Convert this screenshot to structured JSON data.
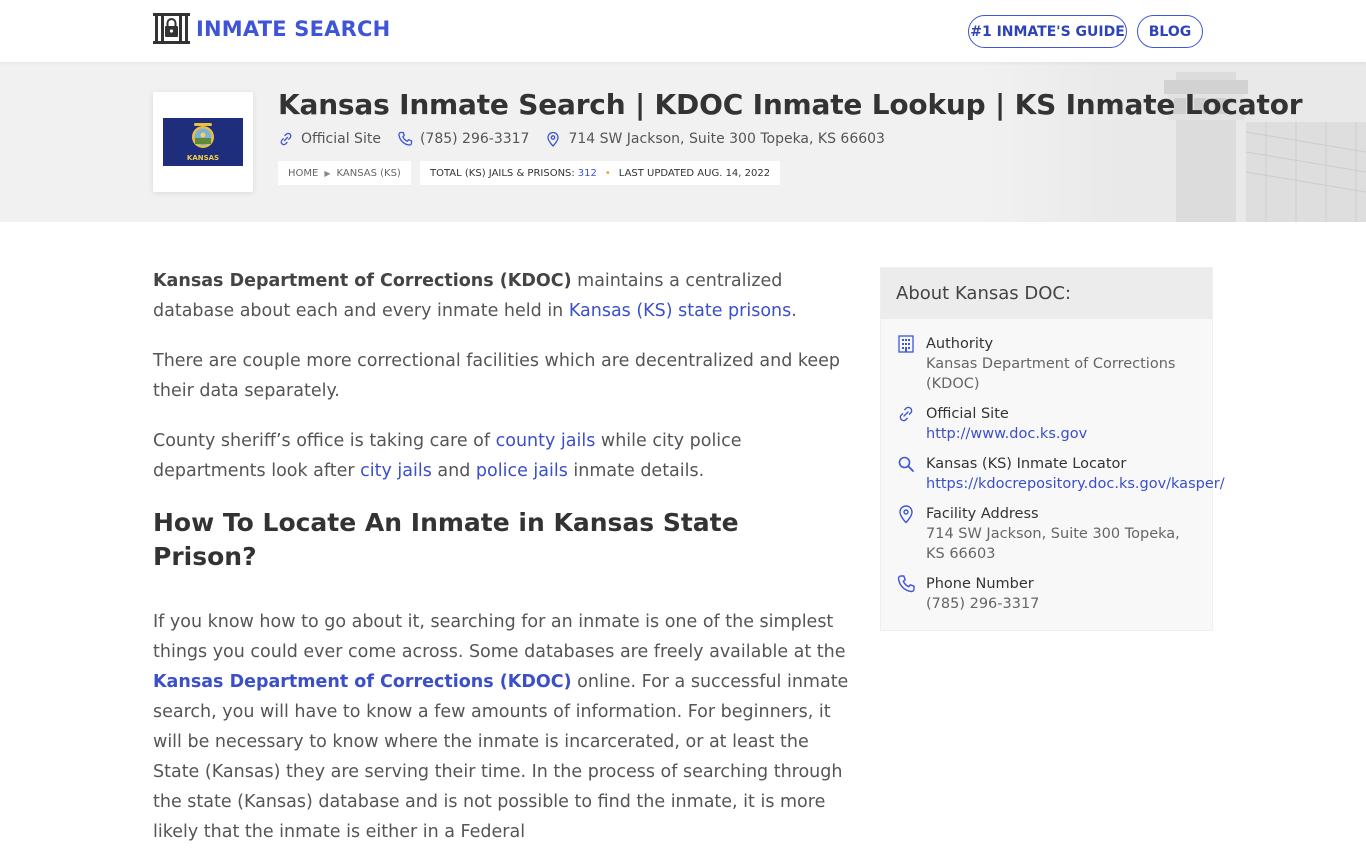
{
  "header": {
    "logo_text": "INMATE SEARCH",
    "nav": {
      "guide": "#1 INMATE'S GUIDE",
      "blog": "BLOG"
    }
  },
  "hero": {
    "flag_text": "KANSAS",
    "title": "Kansas Inmate Search | KDOC Inmate Lookup | KS Inmate Locator",
    "official_site": "Official Site",
    "phone": "(785) 296-3317",
    "address": "714 SW Jackson, Suite 300 Topeka, KS 66603",
    "breadcrumb": {
      "home": "HOME",
      "state": "KANSAS (KS)"
    },
    "stats": {
      "total_label": "TOTAL (KS) JAILS & PRISONS:",
      "total_value": "312",
      "updated": "LAST UPDATED AUG. 14, 2022"
    }
  },
  "content": {
    "p1": {
      "strong": "Kansas Department of Corrections (KDOC)",
      "text1": " maintains a centralized database about each and every inmate held in ",
      "link": "Kansas (KS) state prisons",
      "text2": "."
    },
    "p2": "There are couple more correctional facilities which are decentralized and keep their data separately.",
    "p3": {
      "text1": "County sheriff’s office is taking care of ",
      "link1": "county jails",
      "text2": " while city police departments look after ",
      "link2": "city jails",
      "text3": " and ",
      "link3": "police jails",
      "text4": " inmate details."
    },
    "heading": "How To Locate An Inmate in Kansas State Prison?",
    "p4": {
      "text1": "If you know how to go about it, searching for an inmate is one of the simplest things you could ever come across. Some databases are freely available at the ",
      "link": "Kansas Department of Corrections (KDOC)",
      "text2": " online. For a successful inmate search, you will have to know a few amounts of information. For beginners, it will be necessary to know where the inmate is incarcerated, or at least the State (Kansas) they are serving their time. In the process of searching through the state (Kansas) database and is not possible to find the inmate, it is more likely that the inmate is either in a Federal"
    }
  },
  "sidebar": {
    "title": "About Kansas DOC:",
    "items": [
      {
        "icon": "building-icon",
        "label": "Authority",
        "value": "Kansas Department of Corrections (KDOC)"
      },
      {
        "icon": "link-icon",
        "label": "Official Site",
        "value": "http://www.doc.ks.gov"
      },
      {
        "icon": "search-icon",
        "label": "Kansas (KS) Inmate Locator",
        "value": "https://kdocrepository.doc.ks.gov/kasper/"
      },
      {
        "icon": "map-pin-icon",
        "label": "Facility Address",
        "value": "714 SW Jackson, Suite 300 Topeka, KS 66603"
      },
      {
        "icon": "phone-icon",
        "label": "Phone Number",
        "value": "(785) 296-3317"
      }
    ]
  },
  "colors": {
    "accent": "#3d55d6",
    "link": "#3a4fc8",
    "stat_dot": "#e6a53a",
    "flag_blue": "#1e2e7c"
  }
}
